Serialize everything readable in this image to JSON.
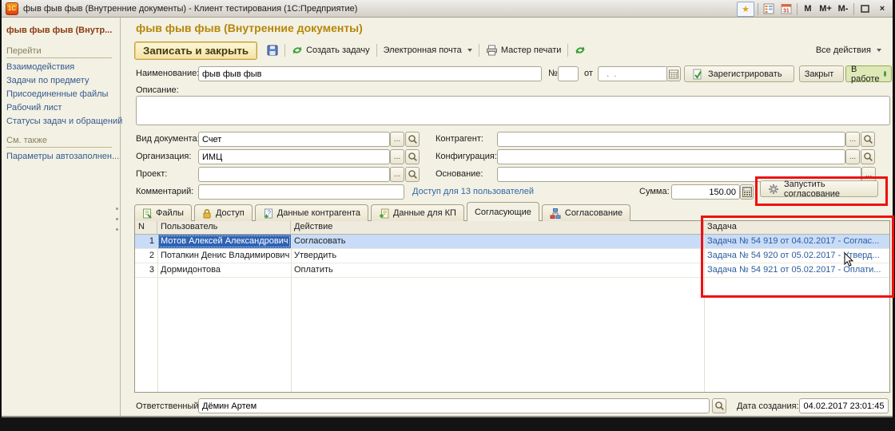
{
  "window": {
    "logo": "1С",
    "title": "фыв фыв фыв (Внутренние документы)  - Клиент тестирования (1С:Предприятие)",
    "m": "M",
    "m_plus": "M+",
    "m_minus": "M-",
    "close": "×"
  },
  "sidebar": {
    "current_item": "фыв фыв фыв (Внутр...",
    "go_header": "Перейти",
    "go_items": [
      "Взаимодействия",
      "Задачи по предмету",
      "Присоединенные файлы",
      "Рабочий лист",
      "Статусы задач и обращений"
    ],
    "see_also_header": "См. также",
    "see_also_items": [
      "Параметры автозаполнен..."
    ]
  },
  "main": {
    "title": "фыв фыв фыв (Внутренние документы)",
    "toolbar": {
      "save_and_close": "Записать и закрыть",
      "create_task": "Создать задачу",
      "email": "Электронная почта",
      "print_master": "Мастер печати",
      "all_actions": "Все действия"
    },
    "form": {
      "name_label": "Наименование:",
      "name_value": "фыв фыв фыв",
      "number_label": "№",
      "number_value": "",
      "date_prep": "от",
      "date_value": "  .  .",
      "register": "Зарегистрировать",
      "closed": "Закрыт",
      "in_work": "В работе",
      "description_label": "Описание:",
      "description_value": "",
      "doc_kind_label": "Вид документа:",
      "doc_kind_value": "Счет",
      "counterparty_label": "Контрагент:",
      "counterparty_value": "",
      "organization_label": "Организация:",
      "organization_value": "ИМЦ",
      "configuration_label": "Конфигурация:",
      "configuration_value": "",
      "project_label": "Проект:",
      "project_value": "",
      "basis_label": "Основание:",
      "basis_value": "",
      "comment_label": "Комментарий:",
      "comment_value": "",
      "access_link": "Доступ для 13 пользователей",
      "sum_label": "Сумма:",
      "sum_value": "150.00",
      "start_approval": "Запустить согласование",
      "ellipsis": "..."
    },
    "tabs": [
      "Файлы",
      "Доступ",
      "Данные контрагента",
      "Данные для КП",
      "Согласующие",
      "Согласование"
    ],
    "table": {
      "columns": [
        "N",
        "Пользователь",
        "Действие",
        "Задача"
      ],
      "rows": [
        {
          "n": "1",
          "user": "Мотов Алексей Александрович",
          "action": "Согласовать",
          "task": "Задача № 54 919 от 04.02.2017 - Соглас..."
        },
        {
          "n": "2",
          "user": "Потапкин Денис Владимирович",
          "action": "Утвердить",
          "task": "Задача № 54 920 от 05.02.2017 - Утверд..."
        },
        {
          "n": "3",
          "user": "Дормидонтова",
          "action": "Оплатить",
          "task": "Задача № 54 921 от 05.02.2017 - Оплати..."
        }
      ]
    },
    "footer": {
      "responsible_label": "Ответственный:",
      "responsible_value": "Дёмин Артем",
      "created_label": "Дата создания:",
      "created_value": "04.02.2017 23:01:45"
    }
  },
  "colors": {
    "annotation_red": "#ee1111",
    "link_blue": "#35598f",
    "selection_blue": "#2d62b4",
    "title_gold": "#b5860b",
    "status_green": "#3f9b3f"
  }
}
